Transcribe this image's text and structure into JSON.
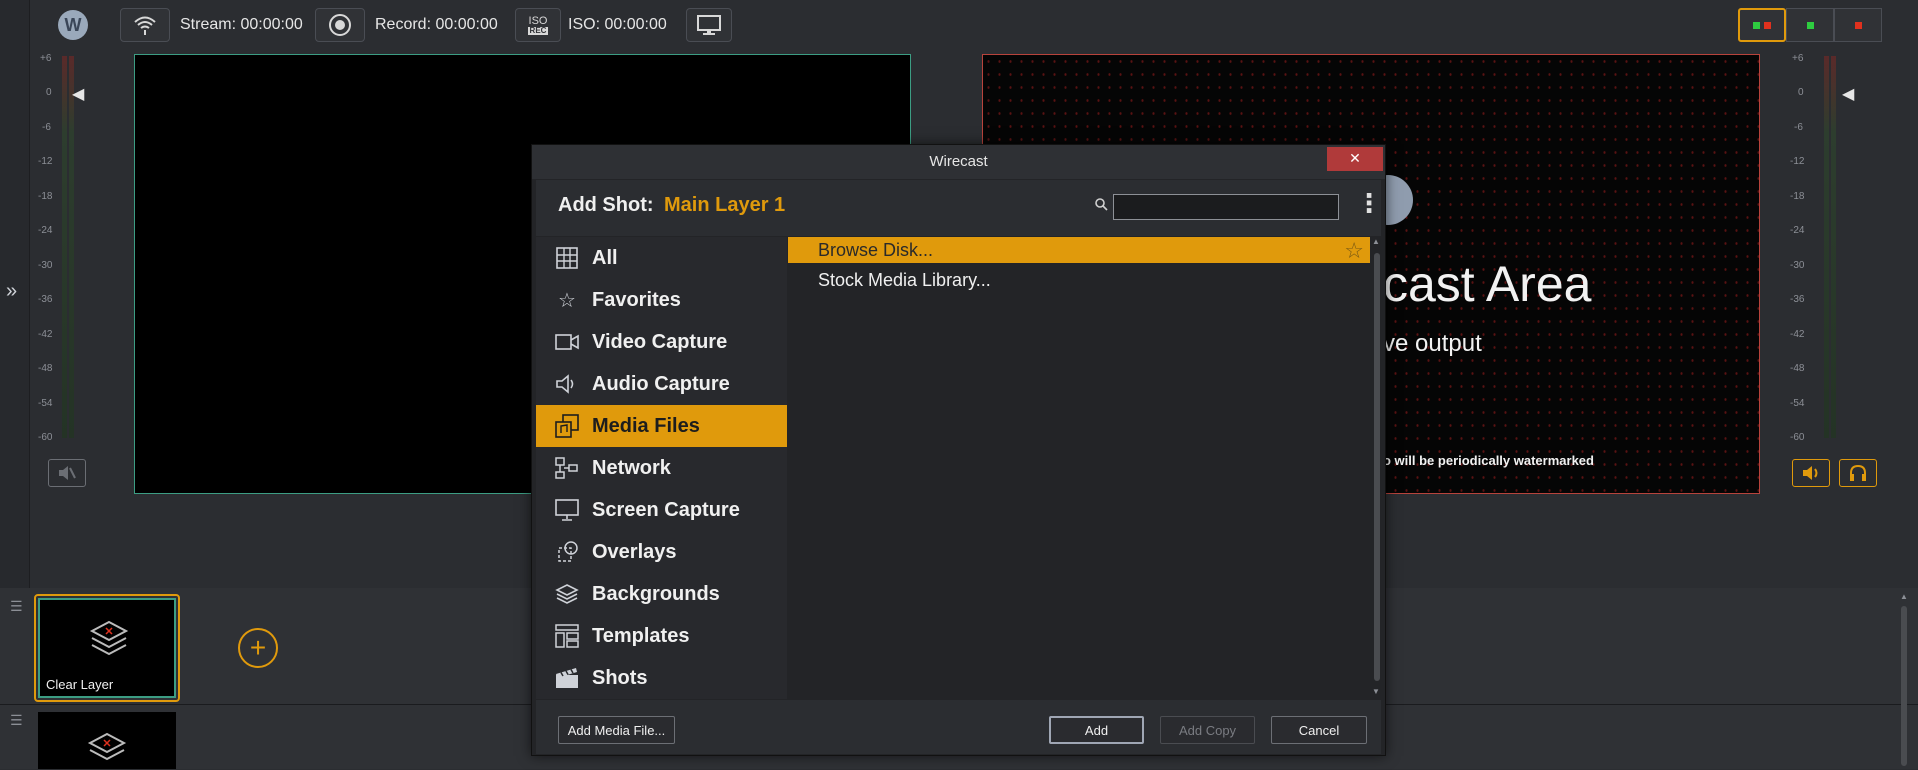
{
  "toolbar": {
    "stream_label": "Stream: 00:00:00",
    "record_label": "Record: 00:00:00",
    "iso_label": "ISO: 00:00:00",
    "iso_icon_top": "ISO",
    "iso_icon_bottom": "REC"
  },
  "meters": {
    "scale": [
      "+6",
      "0",
      "-6",
      "-12",
      "-18",
      "-24",
      "-30",
      "-36",
      "-42",
      "-48",
      "-54",
      "-60"
    ]
  },
  "live": {
    "title": "cast Area",
    "subtitle": "ve output",
    "watermark": "o will be periodically watermarked"
  },
  "layers": {
    "shot1_label": "Clear Layer"
  },
  "dialog": {
    "title": "Wirecast",
    "close": "✕",
    "header_label": "Add Shot:",
    "header_layer": "Main Layer 1",
    "search_value": "",
    "categories": [
      {
        "label": "All",
        "icon": "grid-icon"
      },
      {
        "label": "Favorites",
        "icon": "star-icon"
      },
      {
        "label": "Video Capture",
        "icon": "video-camera-icon"
      },
      {
        "label": "Audio Capture",
        "icon": "speaker-icon"
      },
      {
        "label": "Media Files",
        "icon": "media-files-icon"
      },
      {
        "label": "Network",
        "icon": "network-icon"
      },
      {
        "label": "Screen Capture",
        "icon": "monitor-icon"
      },
      {
        "label": "Overlays",
        "icon": "overlays-icon"
      },
      {
        "label": "Backgrounds",
        "icon": "layers-icon"
      },
      {
        "label": "Templates",
        "icon": "templates-icon"
      },
      {
        "label": "Shots",
        "icon": "clapperboard-icon"
      }
    ],
    "active_category": "Media Files",
    "items": [
      {
        "label": "Browse Disk..."
      },
      {
        "label": "Stock Media Library..."
      }
    ],
    "buttons": {
      "add_media": "Add Media File...",
      "add": "Add",
      "add_copy": "Add Copy",
      "cancel": "Cancel"
    }
  },
  "colors": {
    "accent": "#e09a0c",
    "preview_border": "#3c9d83",
    "live_border": "#b8433c",
    "green": "#2ecc40",
    "red": "#e0311e"
  }
}
